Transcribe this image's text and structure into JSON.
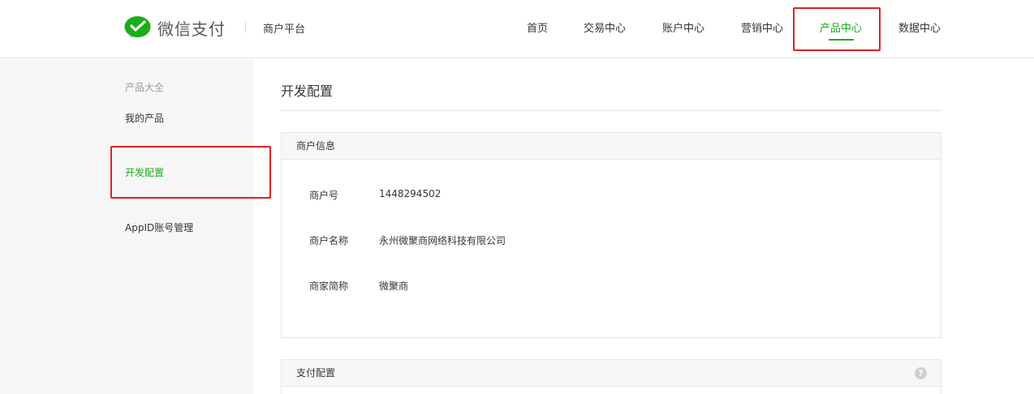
{
  "header": {
    "brand": "微信支付",
    "platform": "商户平台",
    "nav": [
      {
        "label": "首页"
      },
      {
        "label": "交易中心"
      },
      {
        "label": "账户中心"
      },
      {
        "label": "营销中心"
      },
      {
        "label": "产品中心"
      },
      {
        "label": "数据中心"
      }
    ],
    "active_nav": "产品中心"
  },
  "sidebar": {
    "category": "产品大全",
    "items": [
      {
        "label": "我的产品"
      },
      {
        "label": "开发配置"
      },
      {
        "label": "AppID账号管理"
      }
    ],
    "active_item": "开发配置"
  },
  "main": {
    "title": "开发配置",
    "merchant_panel": {
      "title": "商户信息",
      "rows": [
        {
          "label": "商户号",
          "value": "1448294502"
        },
        {
          "label": "商户名称",
          "value": "永州微聚商网络科技有限公司"
        },
        {
          "label": "商家简称",
          "value": "微聚商"
        }
      ]
    },
    "payment_panel": {
      "title": "支付配置",
      "help_icon": "?"
    }
  },
  "colors": {
    "accent": "#1aad19",
    "highlight_box": "#e02020",
    "sidebar_bg": "#f6f6f6"
  },
  "icons": {
    "brand": "wechat-pay-logo-icon",
    "help": "question-circle-icon"
  }
}
